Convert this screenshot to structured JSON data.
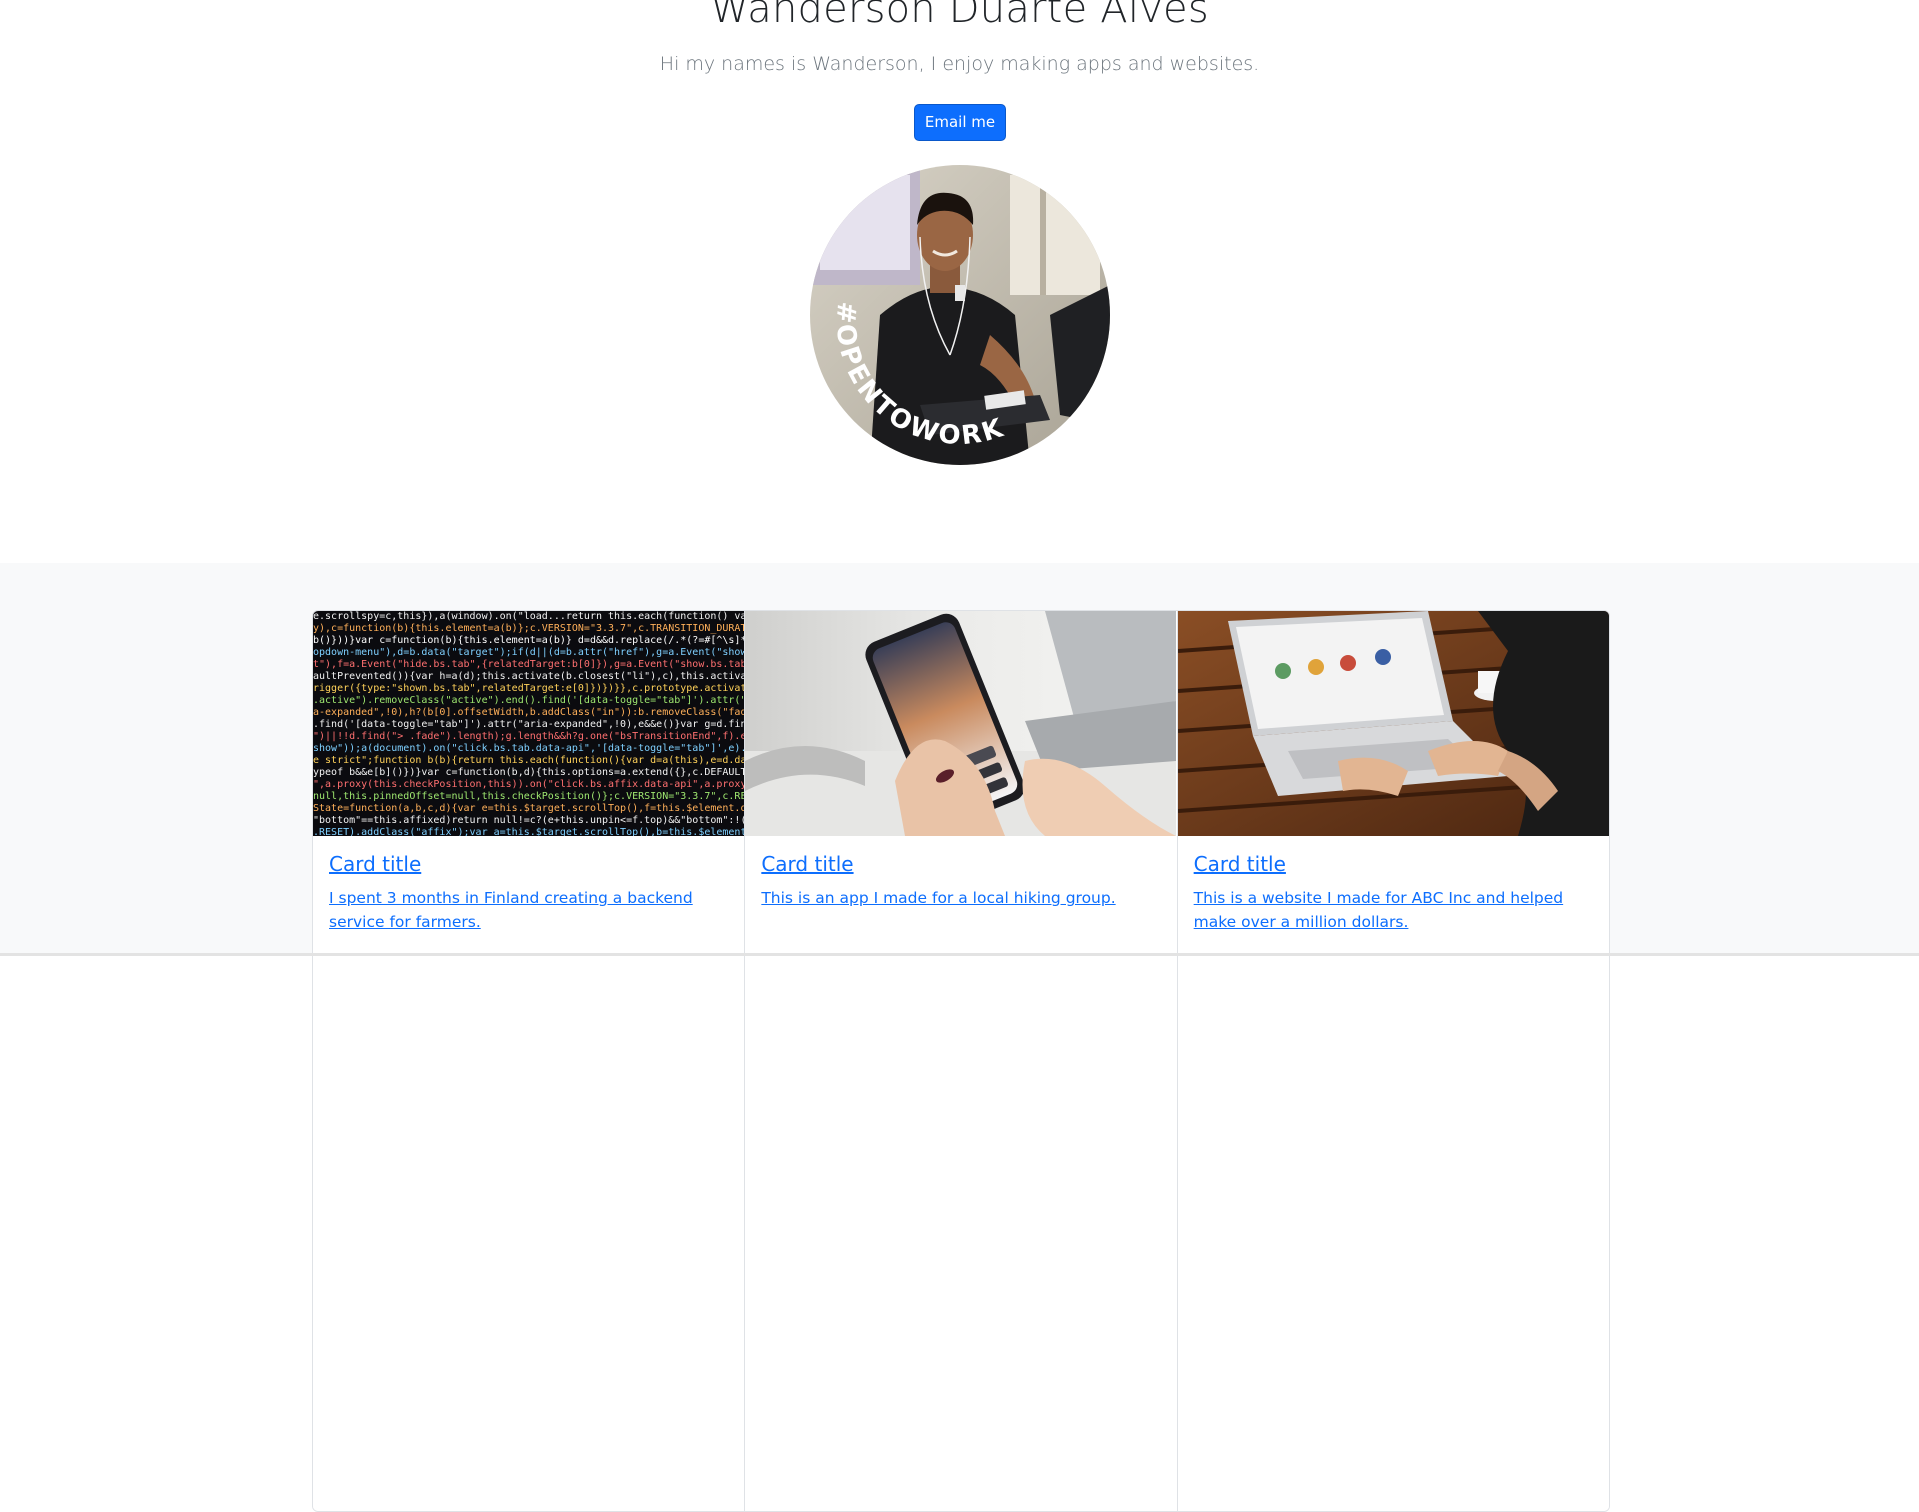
{
  "hero": {
    "name": "Wanderson Duarte Alves",
    "tagline": "Hi my names is Wanderson, I enjoy making apps and websites.",
    "email_button": "Email me",
    "avatar_badge": "#OPENTOWORK"
  },
  "cards": [
    {
      "title": "Card title",
      "text": "I spent 3 months in Finland creating a backend service for farmers.",
      "image": "code-screen-image"
    },
    {
      "title": "Card title",
      "text": "This is an app I made for a local hiking group.",
      "image": "smartphone-in-hands-image"
    },
    {
      "title": "Card title",
      "text": "This is a website I made for ABC Inc and helped make over a million dollars.",
      "image": "laptop-on-table-image"
    }
  ],
  "colors": {
    "primary": "#0d6efd",
    "badge_green": "#3b6d30",
    "section_bg": "#f8f9fa"
  }
}
